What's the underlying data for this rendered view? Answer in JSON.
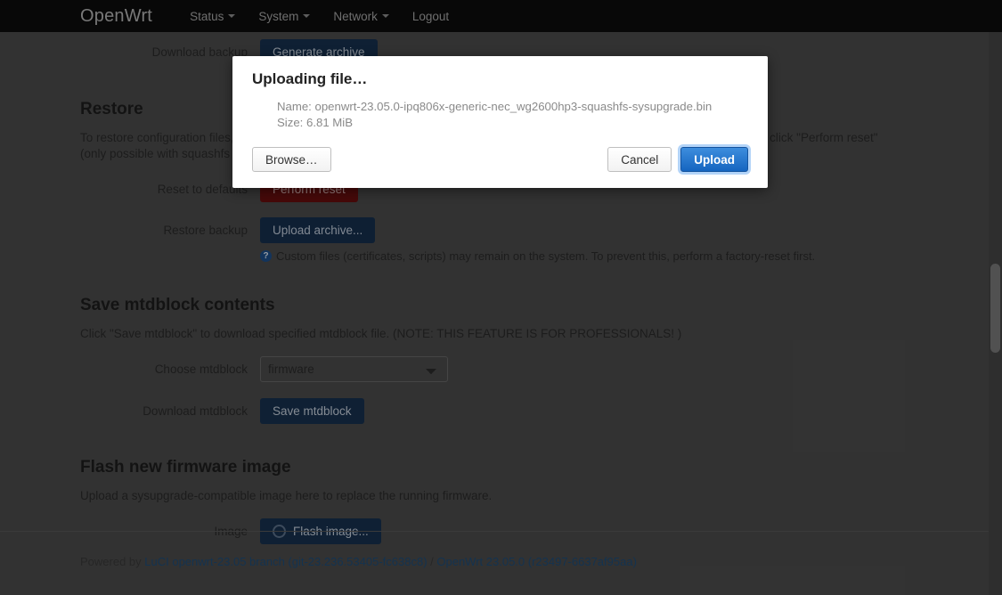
{
  "header": {
    "brand": "OpenWrt",
    "nav": [
      {
        "label": "Status",
        "caret": true
      },
      {
        "label": "System",
        "caret": true
      },
      {
        "label": "Network",
        "caret": true
      },
      {
        "label": "Logout",
        "caret": false
      }
    ]
  },
  "backup": {
    "download_label": "Download backup",
    "generate_button": "Generate archive"
  },
  "restore": {
    "heading": "Restore",
    "description": "To restore configuration files, you can upload a previously generated backup archive here. To reset the firmware to its initial state, click \"Perform reset\" (only possible with squashfs images).",
    "reset_label": "Reset to defaults",
    "reset_button": "Perform reset",
    "restore_label": "Restore backup",
    "upload_button": "Upload archive...",
    "hint_icon": "question-circle-icon",
    "hint": "Custom files (certificates, scripts) may remain on the system. To prevent this, perform a factory-reset first."
  },
  "mtdblock": {
    "heading": "Save mtdblock contents",
    "description": "Click \"Save mtdblock\" to download specified mtdblock file. (NOTE: THIS FEATURE IS FOR PROFESSIONALS! )",
    "choose_label": "Choose mtdblock",
    "selected": "firmware",
    "options": [
      "firmware"
    ],
    "download_label": "Download mtdblock",
    "save_button": "Save mtdblock"
  },
  "flash": {
    "heading": "Flash new firmware image",
    "description": "Upload a sysupgrade-compatible image here to replace the running firmware.",
    "image_label": "Image",
    "flash_button": "Flash image...",
    "flash_icon": "spinner-icon"
  },
  "modal": {
    "title": "Uploading file…",
    "name_line": "Name: openwrt-23.05.0-ipq806x-generic-nec_wg2600hp3-squashfs-sysupgrade.bin",
    "size_line": "Size: 6.81 MiB",
    "browse_button": "Browse…",
    "cancel_button": "Cancel",
    "upload_button": "Upload"
  },
  "footer": {
    "powered_by": "Powered by ",
    "luci_link": "LuCI openwrt-23.05 branch (git-23.236.53405-fc638c8)",
    "separator": " / ",
    "openwrt_link": "OpenWrt 23.05.0 (r23497-6637af95aa)"
  },
  "colors": {
    "header_bg": "#0d0d0d",
    "page_bg": "#4d4d4d",
    "primary_button": "#18314f",
    "danger_button": "#6b0f0f",
    "modal_primary": "#1565c0",
    "link": "#1f4e79"
  }
}
